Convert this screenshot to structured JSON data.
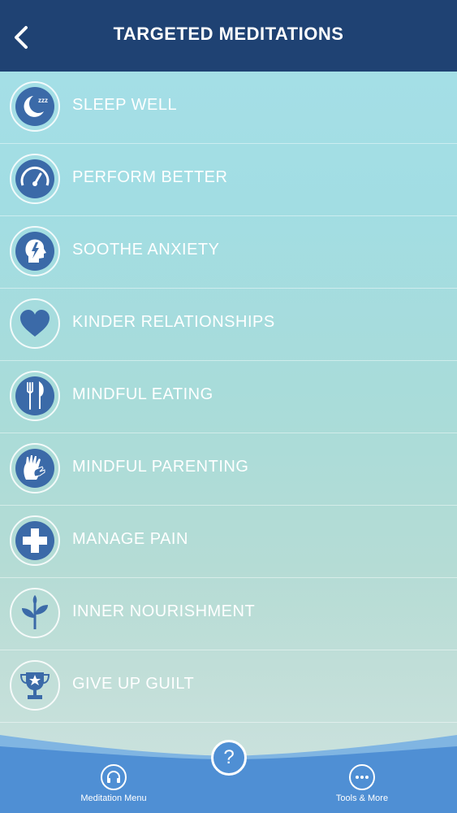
{
  "header": {
    "title": "TARGETED MEDITATIONS",
    "back_icon": "chevron-left-icon"
  },
  "colors": {
    "header_bg": "#1f4273",
    "icon_fill": "#3b6aa8",
    "tabbar_bg": "#4f8fd4"
  },
  "list": [
    {
      "label": "SLEEP WELL",
      "icon": "moon-sleep-icon"
    },
    {
      "label": "PERFORM BETTER",
      "icon": "speedometer-icon"
    },
    {
      "label": "SOOTHE ANXIETY",
      "icon": "head-lightning-icon"
    },
    {
      "label": "KINDER RELATIONSHIPS",
      "icon": "heart-icon"
    },
    {
      "label": "MINDFUL EATING",
      "icon": "fork-knife-icon"
    },
    {
      "label": "MINDFUL PARENTING",
      "icon": "hands-icon"
    },
    {
      "label": "MANAGE PAIN",
      "icon": "medical-cross-icon"
    },
    {
      "label": "INNER NOURISHMENT",
      "icon": "sprout-icon"
    },
    {
      "label": "GIVE UP GUILT",
      "icon": "trophy-icon"
    }
  ],
  "tabbar": {
    "help_label": "?",
    "items": [
      {
        "label": "Meditation Menu",
        "icon": "headphones-icon"
      },
      {
        "label": "Tools & More",
        "icon": "more-icon"
      }
    ]
  }
}
